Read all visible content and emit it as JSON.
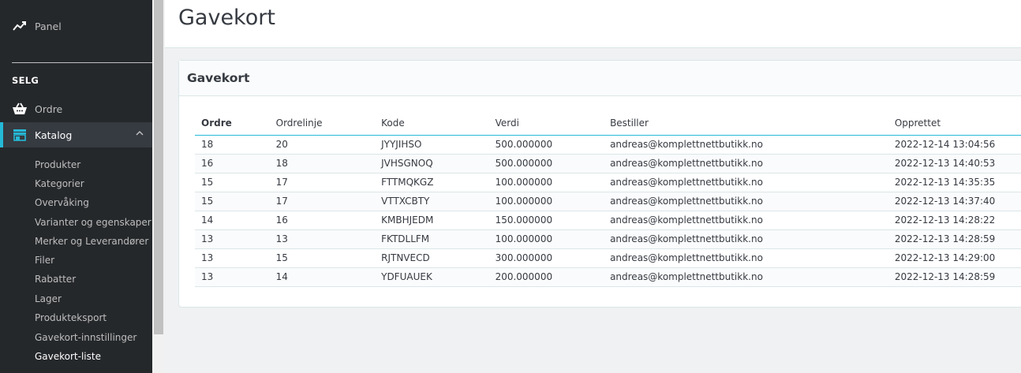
{
  "sidebar": {
    "panel_label": "Panel",
    "section_title": "SELG",
    "ordre_label": "Ordre",
    "katalog_label": "Katalog",
    "submenu": [
      "Produkter",
      "Kategorier",
      "Overvåking",
      "Varianter og egenskaper",
      "Merker og Leverandører",
      "Filer",
      "Rabatter",
      "Lager",
      "Produkteksport",
      "Gavekort-innstillinger",
      "Gavekort-liste"
    ],
    "active_submenu": "Gavekort-liste"
  },
  "header": {
    "title": "Gavekort"
  },
  "card": {
    "title": "Gavekort",
    "columns": [
      "Ordre",
      "Ordrelinje",
      "Kode",
      "Verdi",
      "Bestiller",
      "Opprettet"
    ],
    "rows": [
      [
        "18",
        "20",
        "JYYJIHSO",
        "500.000000",
        "andreas@komplettnettbutikk.no",
        "2022-12-14 13:04:56"
      ],
      [
        "16",
        "18",
        "JVHSGNOQ",
        "500.000000",
        "andreas@komplettnettbutikk.no",
        "2022-12-13 14:40:53"
      ],
      [
        "15",
        "17",
        "FTTMQKGZ",
        "100.000000",
        "andreas@komplettnettbutikk.no",
        "2022-12-13 14:35:35"
      ],
      [
        "15",
        "17",
        "VTTXCBTY",
        "100.000000",
        "andreas@komplettnettbutikk.no",
        "2022-12-13 14:37:40"
      ],
      [
        "14",
        "16",
        "KMBHJEDM",
        "150.000000",
        "andreas@komplettnettbutikk.no",
        "2022-12-13 14:28:22"
      ],
      [
        "13",
        "13",
        "FKTDLLFM",
        "100.000000",
        "andreas@komplettnettbutikk.no",
        "2022-12-13 14:28:59"
      ],
      [
        "13",
        "15",
        "RJTNVECD",
        "300.000000",
        "andreas@komplettnettbutikk.no",
        "2022-12-13 14:29:00"
      ],
      [
        "13",
        "14",
        "YDFUAUEK",
        "200.000000",
        "andreas@komplettnettbutikk.no",
        "2022-12-13 14:28:59"
      ]
    ]
  },
  "icons": {
    "panel": "trending-up-icon",
    "ordre": "shopping-basket-icon",
    "katalog": "store-icon",
    "chevron": "chevron-up-icon"
  },
  "colors": {
    "accent": "#25b9d7",
    "sidebar_bg": "#25282b"
  }
}
